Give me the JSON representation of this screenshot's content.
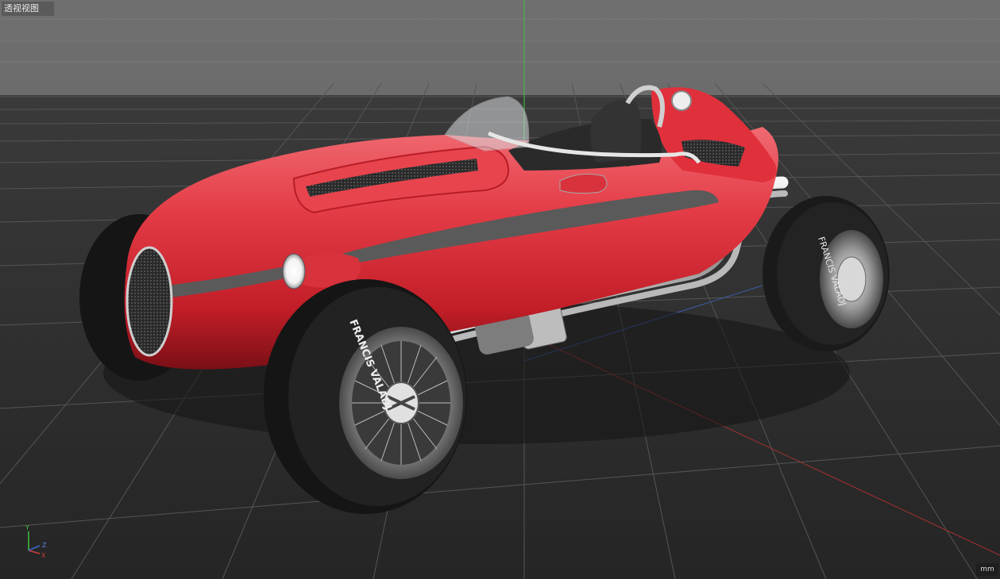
{
  "viewport": {
    "view_label": "透视视图",
    "unit": "mm",
    "axes": {
      "y": "Y",
      "z": "Z",
      "x": "X"
    }
  },
  "model": {
    "tire_brand_front": "FRANCIS VALADJ",
    "tire_brand_rear": "FRANCIS VALADJ",
    "body_color": "#d8323c",
    "accent_stripe_color": "#5a5a5a"
  },
  "colors": {
    "background_top": "#6b6b6b",
    "floor": "#2a2a2a",
    "grid_line": "#8a8a8a",
    "axis_y": "#3ec43e",
    "axis_x": "#d23c3c",
    "axis_z": "#3c6ad2"
  }
}
